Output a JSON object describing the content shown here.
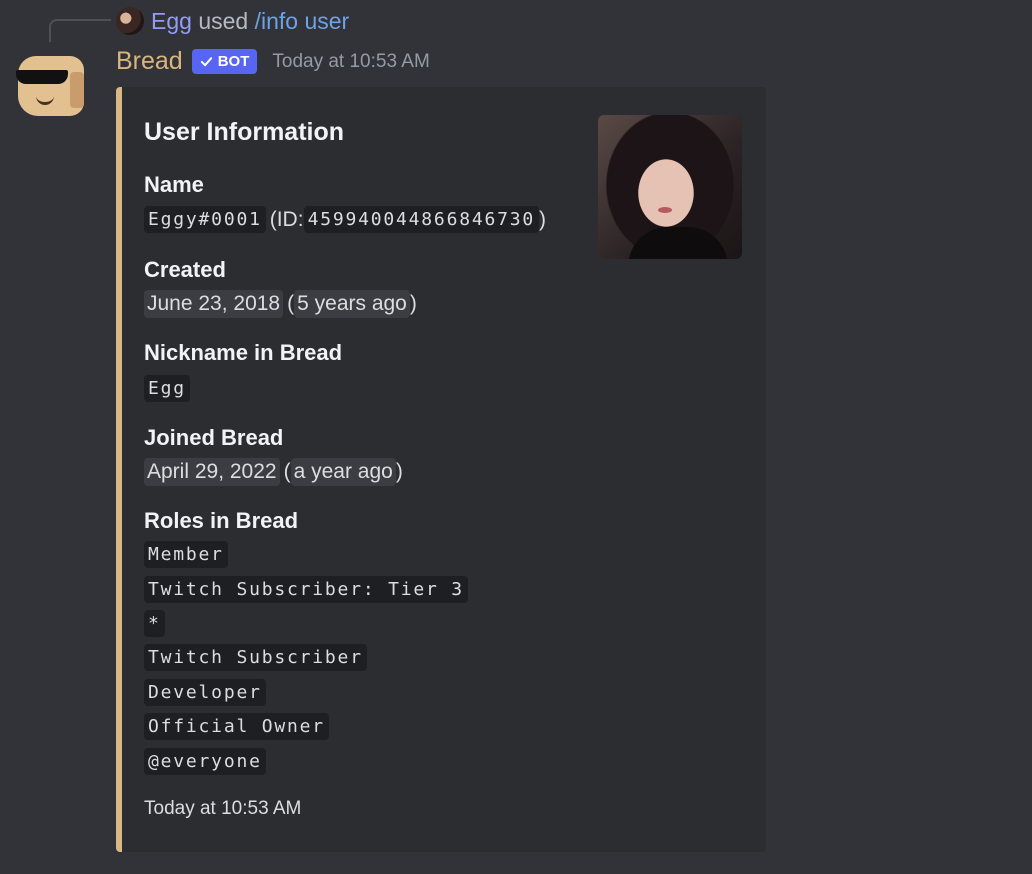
{
  "reply": {
    "user": "Egg",
    "verb": "used",
    "command": "/info user"
  },
  "message": {
    "author": "Bread",
    "bot_tag": "BOT",
    "bot_check_icon": "check-icon",
    "timestamp": "Today at 10:53 AM"
  },
  "embed": {
    "title": "User Information",
    "accent_color": "#d8b886",
    "fields": {
      "name": {
        "label": "Name",
        "tag": "Eggy#0001",
        "id_prefix": "(ID: ",
        "id": "459940044866846730",
        "id_suffix": ")"
      },
      "created": {
        "label": "Created",
        "date": "June 23, 2018",
        "open": "(",
        "relative": "5 years ago",
        "close": ")"
      },
      "nickname": {
        "label": "Nickname in Bread",
        "value": "Egg"
      },
      "joined": {
        "label": "Joined Bread",
        "date": "April 29, 2022",
        "open": "(",
        "relative": "a year ago",
        "close": ")"
      },
      "roles": {
        "label": "Roles in Bread",
        "items": [
          "Member",
          "Twitch Subscriber: Tier 3",
          "*",
          "Twitch Subscriber",
          "Developer",
          "Official Owner",
          "@everyone"
        ]
      }
    },
    "footer": "Today at 10:53 AM"
  },
  "colors": {
    "background": "#313338",
    "embed_background": "#2b2d31",
    "bot_tag": "#5865f2",
    "author_name": "#d9b57f",
    "reply_name": "#949cf7",
    "command_link": "#6ea2e6"
  }
}
